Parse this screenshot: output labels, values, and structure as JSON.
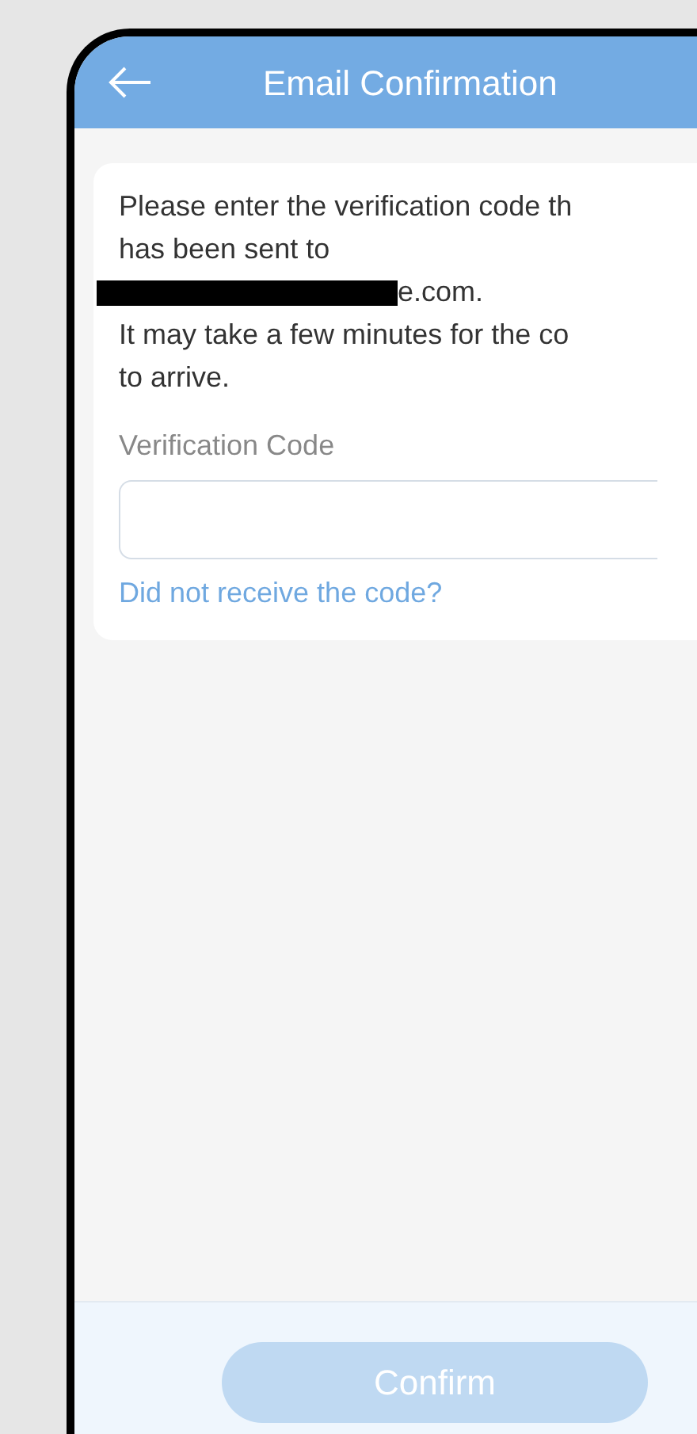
{
  "header": {
    "title": "Email Confirmation"
  },
  "message": {
    "lines": [
      {
        "kind": "text",
        "text": "Please enter the verification code th"
      },
      {
        "kind": "text",
        "text": "has been sent to"
      },
      {
        "kind": "redacted",
        "text": "e.com."
      },
      {
        "kind": "text",
        "text": "It may take a few minutes for the co"
      },
      {
        "kind": "text",
        "text": "to arrive."
      }
    ]
  },
  "field": {
    "label": "Verification Code"
  },
  "resend_link": "Did not receive the code?",
  "confirm_button": {
    "label": "Confirm",
    "disabled": true
  }
}
